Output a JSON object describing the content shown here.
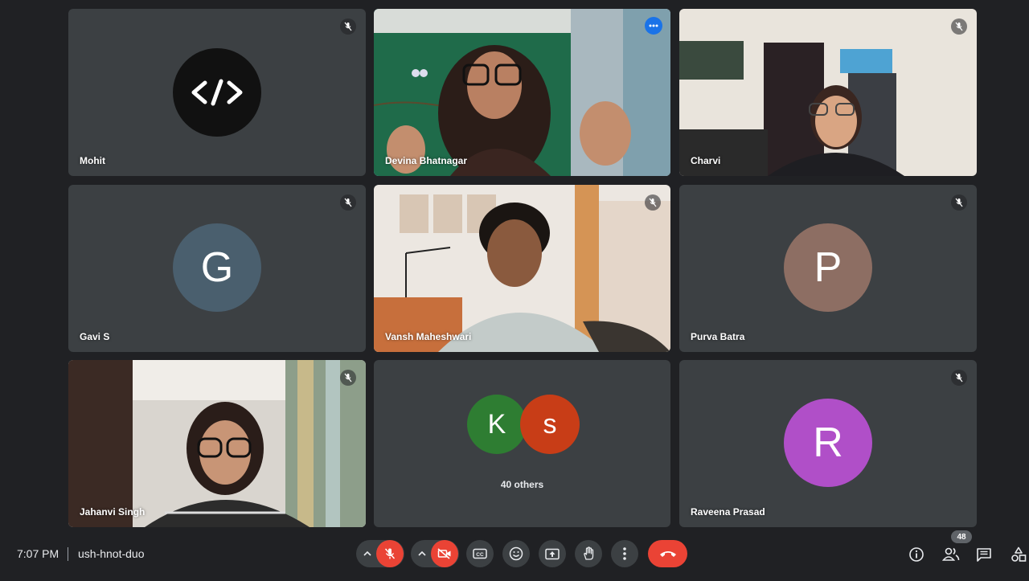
{
  "participants": [
    {
      "name": "Mohit",
      "type": "logo",
      "muted": true
    },
    {
      "name": "Devina Bhatnagar",
      "type": "video",
      "active_speaker": true
    },
    {
      "name": "Charvi",
      "type": "video",
      "muted": true
    },
    {
      "name": "Gavi S",
      "type": "avatar",
      "initial": "G",
      "color": "#4a5f6e",
      "muted": true
    },
    {
      "name": "Vansh Maheshwari",
      "type": "video",
      "muted": true
    },
    {
      "name": "Purva Batra",
      "type": "avatar",
      "initial": "P",
      "color": "#8d6e63",
      "muted": true
    },
    {
      "name": "Jahanvi Singh",
      "type": "video",
      "muted": true
    },
    {
      "name": "Raveena Prasad",
      "type": "avatar",
      "initial": "R",
      "color": "#b04fc8",
      "muted": true
    }
  ],
  "others_tile": {
    "avatars": [
      {
        "initial": "K",
        "color": "#2e7d32"
      },
      {
        "initial": "s",
        "color": "#c83d17"
      }
    ],
    "label": "40 others"
  },
  "bottombar": {
    "time": "7:07 PM",
    "meeting_code": "ush-hnot-duo",
    "people_count": "48",
    "controls": [
      "mic-off",
      "camera-off",
      "captions",
      "emoji",
      "present",
      "raise-hand",
      "more-options",
      "leave-call"
    ],
    "side_controls": [
      "meeting-details",
      "people",
      "chat",
      "activities"
    ]
  },
  "colors": {
    "background": "#202124",
    "tile": "#3c4043",
    "accent_active": "#8ab4f8",
    "danger": "#ea4335"
  }
}
